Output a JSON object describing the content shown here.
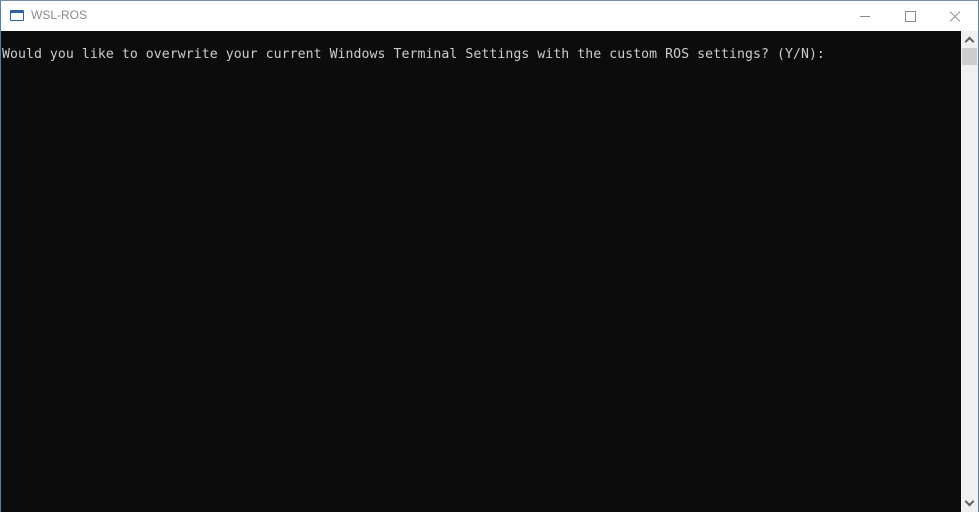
{
  "window": {
    "title": "WSL-ROS",
    "app_icon": "console-window-icon",
    "controls": {
      "minimize": "minimize-icon",
      "maximize": "maximize-icon",
      "close": "close-icon"
    }
  },
  "terminal": {
    "lines": [
      "Would you like to overwrite your current Windows Terminal Settings with the custom ROS settings? (Y/N): "
    ],
    "background": "#0c0c0c",
    "foreground": "#cccccc"
  },
  "scrollbar": {
    "up_icon": "chevron-up-icon",
    "down_icon": "chevron-down-icon"
  }
}
